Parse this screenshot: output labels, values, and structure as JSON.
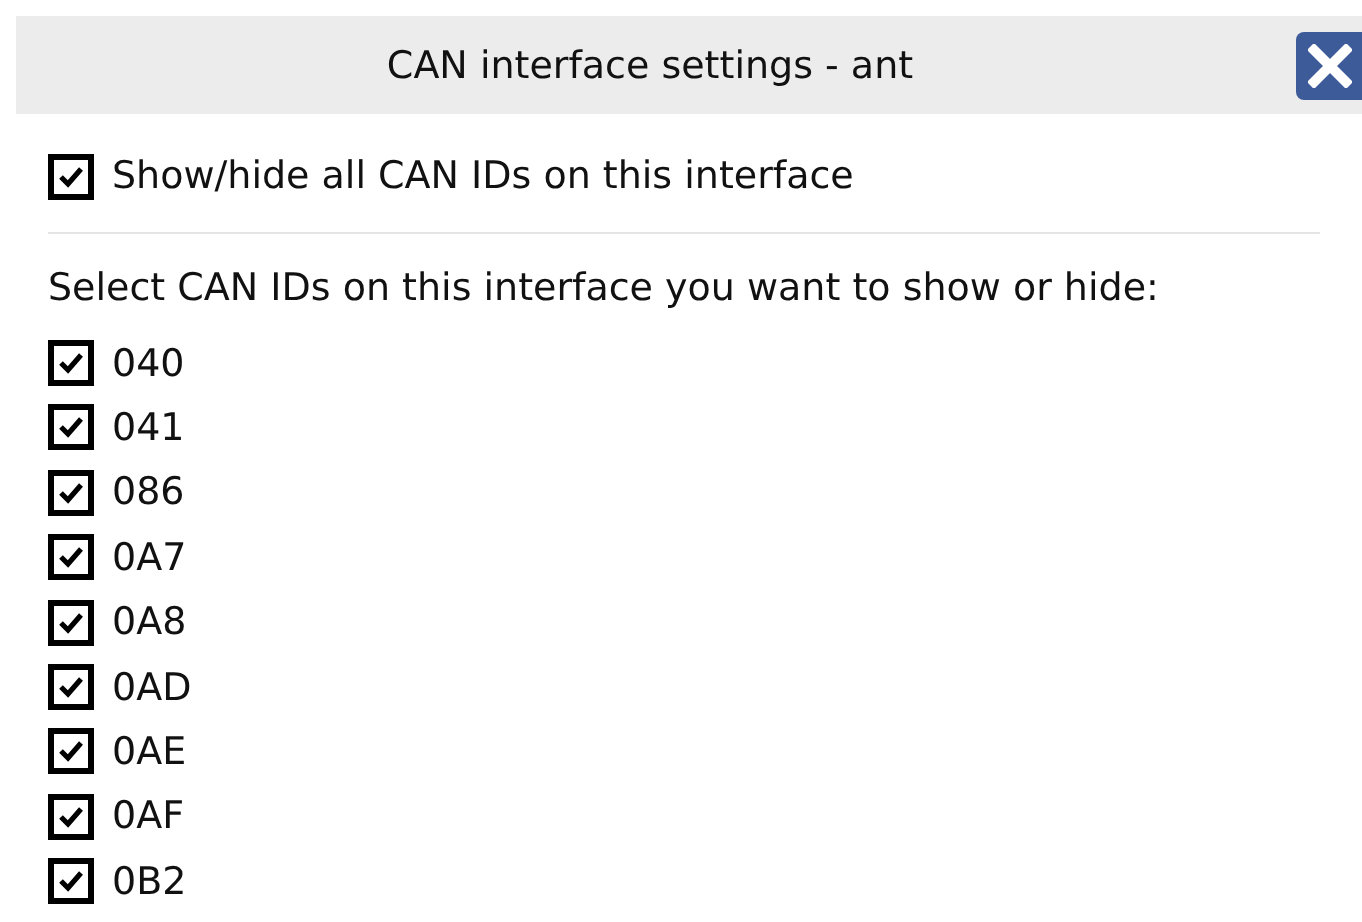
{
  "window": {
    "title": "CAN interface settings - ant"
  },
  "show_all": {
    "label": "Show/hide all CAN IDs on this interface",
    "checked": true
  },
  "instruction": "Select CAN IDs on this interface you want to show or hide:",
  "can_ids": [
    {
      "label": "040",
      "checked": true
    },
    {
      "label": "041",
      "checked": true
    },
    {
      "label": "086",
      "checked": true
    },
    {
      "label": "0A7",
      "checked": true
    },
    {
      "label": "0A8",
      "checked": true
    },
    {
      "label": "0AD",
      "checked": true
    },
    {
      "label": "0AE",
      "checked": true
    },
    {
      "label": "0AF",
      "checked": true
    },
    {
      "label": "0B2",
      "checked": true
    }
  ]
}
